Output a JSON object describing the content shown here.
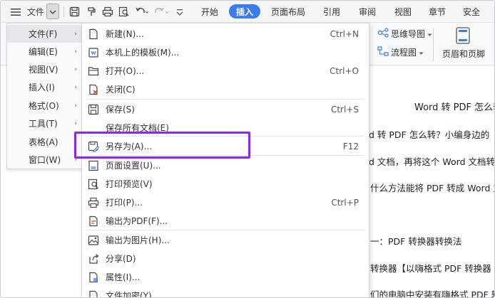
{
  "toolbar": {
    "file_label": "文件",
    "tabs": [
      "开始",
      "插入",
      "页面布局",
      "引用",
      "审阅",
      "视图",
      "章节",
      "安全"
    ],
    "active_tab_index": 1,
    "accent_color": "#3c7cf0"
  },
  "ribbon": {
    "mindmap_label": "思维导图",
    "flowchart_label": "流程图",
    "header_footer_label": "页眉和页脚"
  },
  "left_menu": {
    "items": [
      {
        "label": "文件(F)",
        "arrow": "›"
      },
      {
        "label": "编辑(E)",
        "arrow": "›"
      },
      {
        "label": "视图(V)",
        "arrow": "›"
      },
      {
        "label": "插入(I)",
        "arrow": "›"
      },
      {
        "label": "格式(O)",
        "arrow": "›"
      },
      {
        "label": "工具(T)",
        "arrow": "›"
      },
      {
        "label": "表格(A)",
        "arrow": "›"
      },
      {
        "label": "窗口(W)",
        "arrow": "›"
      }
    ]
  },
  "sub_menu": {
    "items": [
      {
        "label": "新建(N)...",
        "shortcut": "Ctrl+N",
        "icon": "new-doc-icon"
      },
      {
        "label": "本机上的模板(M)...",
        "shortcut": "",
        "icon": "template-icon"
      },
      {
        "label": "打开(O)...",
        "shortcut": "Ctrl+O",
        "icon": "folder-open-icon"
      },
      {
        "label": "关闭(C)",
        "shortcut": "",
        "icon": "close-doc-icon"
      },
      {
        "label": "保存(S)",
        "shortcut": "Ctrl+S",
        "icon": "save-icon"
      },
      {
        "label": "保存所有文档(E)",
        "shortcut": "",
        "icon": ""
      },
      {
        "label": "另存为(A)...",
        "shortcut": "F12",
        "icon": "save-as-icon"
      },
      {
        "label": "页面设置(U)...",
        "shortcut": "",
        "icon": "page-setup-icon"
      },
      {
        "label": "打印预览(V)",
        "shortcut": "",
        "icon": "print-preview-icon"
      },
      {
        "label": "打印(P)...",
        "shortcut": "Ctrl+P",
        "icon": "print-icon"
      },
      {
        "label": "输出为PDF(F)...",
        "shortcut": "",
        "icon": "export-pdf-icon"
      },
      {
        "label": "输出为图片(H)...",
        "shortcut": "",
        "icon": "export-image-icon"
      },
      {
        "label": "分享(D)",
        "shortcut": "",
        "icon": "share-icon"
      },
      {
        "label": "属性(I)...",
        "shortcut": "",
        "icon": "properties-icon"
      },
      {
        "label": "文件加密(Y)...",
        "shortcut": "",
        "icon": "encrypt-icon"
      }
    ],
    "highlight_color": "#8a2be2"
  },
  "document": {
    "lines": [
      "Word 转 PDF 怎么转",
      "d 转 PDF 怎么转？小编身边的",
      "d 文档，再将这个 Word 文档转",
      "什么方法能将 PDF 转成 Word 文",
      "一：PDF 转换器转换法",
      "转换器【以嗨格式 PDF 转换器",
      "们的电脑中安装有嗨格式 PDF 转"
    ]
  }
}
